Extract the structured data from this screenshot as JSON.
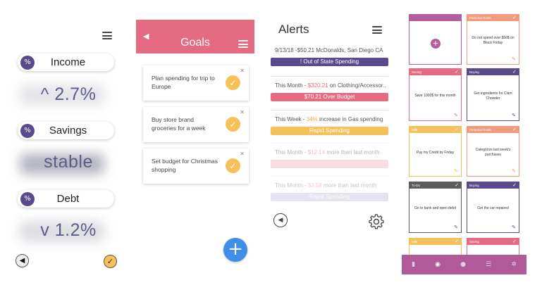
{
  "finance": {
    "percent_symbol": "%",
    "items": [
      {
        "label": "Income",
        "value": "^ 2.7%"
      },
      {
        "label": "Savings",
        "value": "stable"
      },
      {
        "label": "Debt",
        "value": "v 1.2%"
      }
    ],
    "back_icon": "triangle-left-icon",
    "confirm_icon": "check-icon"
  },
  "goals": {
    "title": "Goals",
    "back_glyph": "◀",
    "cards": [
      {
        "text": "Plan spending for trip to Europe"
      },
      {
        "text": "Buy store brand groceries for a week"
      },
      {
        "text": "Set budget for Christmas shopping"
      }
    ],
    "add_glyph": "+"
  },
  "alerts": {
    "title": "Alerts",
    "items": [
      {
        "text": "9/13/18 -$50.21 McDonalds, San Diego CA",
        "tag": "! Out of State Spending",
        "color": "#5b4a8b"
      },
      {
        "text": "This Month - $320.21 on Clothing/Accessor..",
        "tag": "$70.21 Over Budget",
        "color": "#e56b82"
      },
      {
        "text": "This Week - 34% increase in Gas spending",
        "tag": "Rapid Spending",
        "color": "#f7c15a"
      },
      {
        "text": "This Month - $12.14 more than last month",
        "tag": "",
        "color": "#f6dbe1"
      },
      {
        "text": "This Month - $3.58 more than last month",
        "tag": "Rapid Spending",
        "color": "#e3dfee"
      }
    ],
    "alert2_parts": [
      "This Month - ",
      "$320.21",
      " on Clothing/Accessor.."
    ],
    "alert3_parts": [
      "This Week - ",
      "34%",
      " increase in Gas spending"
    ],
    "alert4_parts": [
      "This Month - ",
      "$12.14",
      " more than last month"
    ],
    "alert5_parts": [
      "This Month - ",
      "$3.58",
      " more than last month"
    ]
  },
  "board": {
    "notes": [
      {
        "title": "",
        "body": "",
        "color": "#b45c9e"
      },
      {
        "title": "Personal Goals",
        "body": "Do not spend over $50$ on Black Friday",
        "color": "#f29a7c"
      },
      {
        "title": "Saving",
        "body": "Save 1000$ for this month",
        "color": "#e56b82"
      },
      {
        "title": "Buying",
        "body": "Get ingredients for Clam Chowder",
        "color": "#5b4a8b"
      },
      {
        "title": "Bills",
        "body": "Pay my Credit by Friday",
        "color": "#f7c15a"
      },
      {
        "title": "Personal Goals",
        "body": "Categorize last week's purchases",
        "color": "#f29a7c"
      },
      {
        "title": "To-Do",
        "body": "Go to bank and open debit",
        "color": "#5c5c5c"
      },
      {
        "title": "Buying",
        "body": "Get the car repaired",
        "color": "#5b4a8b"
      },
      {
        "title": "Bills",
        "body": "",
        "color": "#f7c15a"
      },
      {
        "title": "Saving",
        "body": "",
        "color": "#e56b82"
      }
    ],
    "nav_icons": [
      "bookmark-icon",
      "compass-icon",
      "person-icon",
      "list-icon",
      "gear-icon"
    ]
  }
}
